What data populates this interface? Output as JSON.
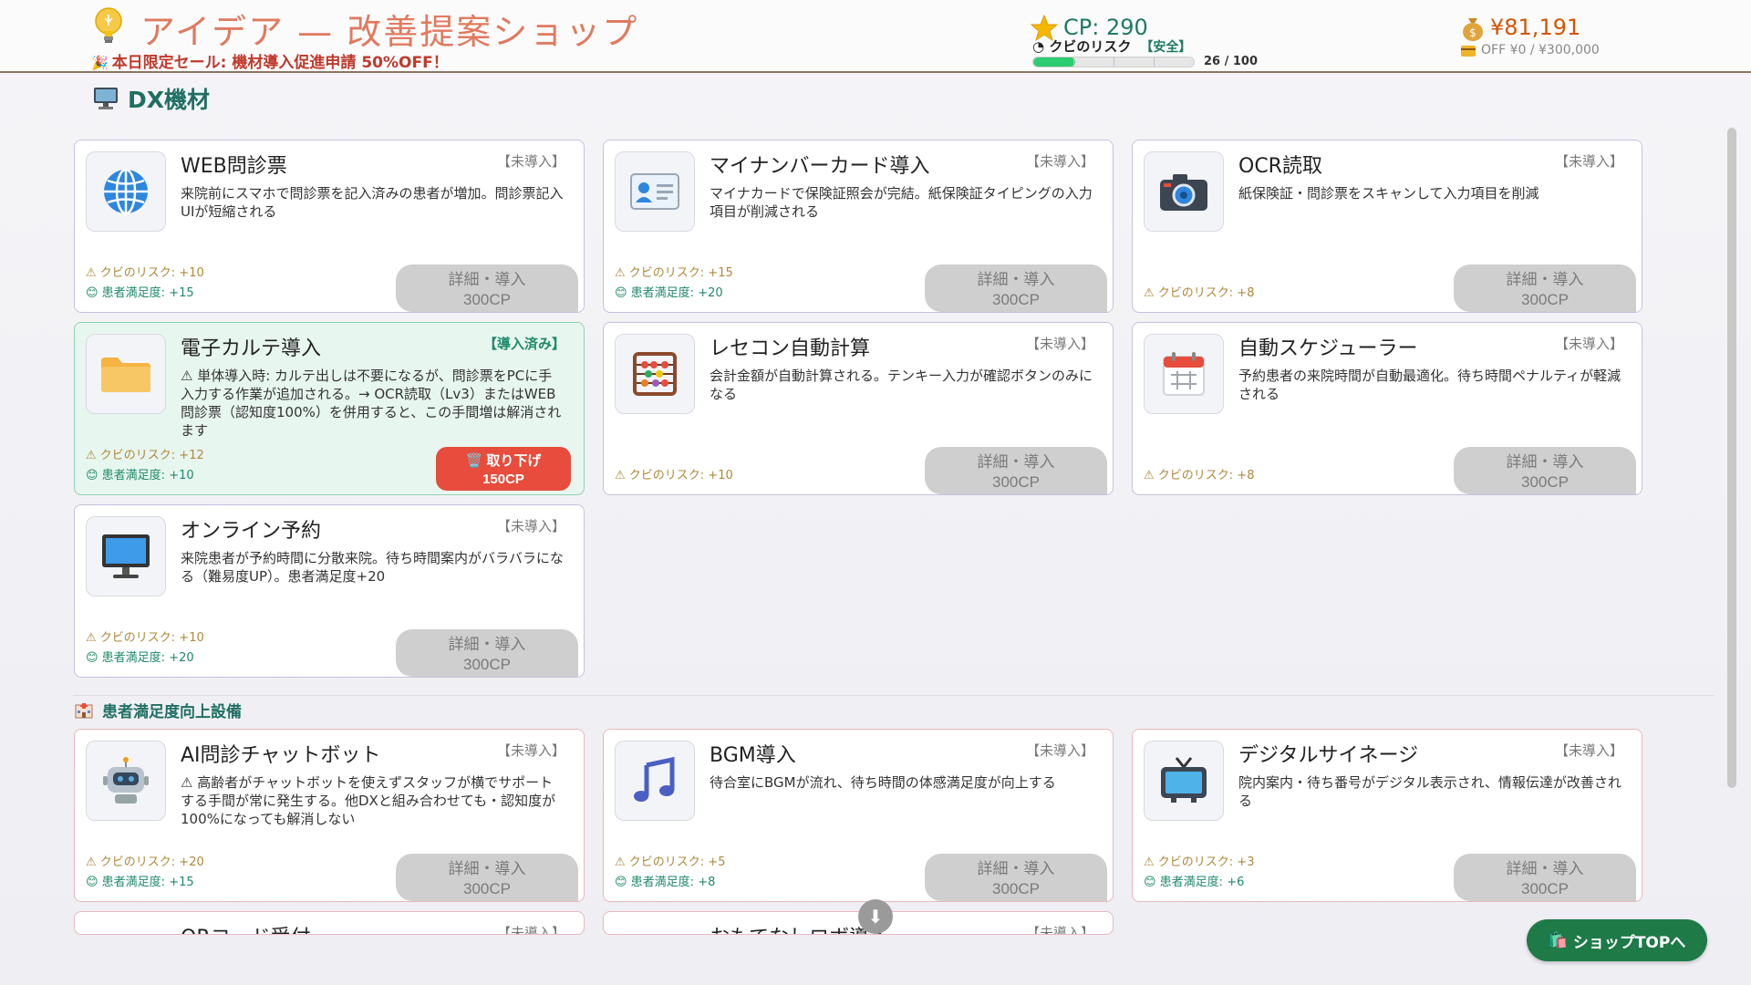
{
  "header": {
    "title": "アイデア — 改善提案ショップ",
    "sale": "本日限定セール: 機材導入促進申請 50%OFF！",
    "cp": "CP: 290",
    "risk_label": "クビのリスク",
    "risk_status": "【安全】",
    "risk_value": 26,
    "risk_max": 100,
    "risk_count": "26 / 100",
    "money": "¥81,191",
    "off_line": "OFF ¥0 / ¥300,000"
  },
  "sections": {
    "dx_title": "DX機材",
    "sat_title": "患者満足度向上設備"
  },
  "cards": [
    {
      "name": "WEB問診票",
      "status": "【未導入】",
      "desc": "来院前にスマホで問診票を記入済みの患者が増加。問診票記入UIが短縮される",
      "risk": "⚠ クビのリスク: +10",
      "satis": "😊 患者満足度: +15",
      "btn1": "詳細・導入",
      "btn2": "300CP"
    },
    {
      "name": "マイナンバーカード導入",
      "status": "【未導入】",
      "desc": "マイナカードで保険証照会が完結。紙保険証タイピングの入力項目が削減される",
      "risk": "⚠ クビのリスク: +15",
      "satis": "😊 患者満足度: +20",
      "btn1": "詳細・導入",
      "btn2": "300CP"
    },
    {
      "name": "OCR読取",
      "status": "【未導入】",
      "desc": "紙保険証・問診票をスキャンして入力項目を削減",
      "risk": "⚠ クビのリスク: +8",
      "satis": "",
      "btn1": "詳細・導入",
      "btn2": "300CP"
    },
    {
      "name": "電子カルテ導入",
      "status": "【導入済み】",
      "desc": "⚠ 単体導入時: カルテ出しは不要になるが、問診票をPCに手入力する作業が追加される。→ OCR読取（Lv3）またはWEB問診票（認知度100%）を併用すると、この手間増は解消されます",
      "risk": "⚠ クビのリスク: +12",
      "satis": "😊 患者満足度: +10",
      "btn1": "🗑️ 取り下げ",
      "btn2": "150CP"
    },
    {
      "name": "レセコン自動計算",
      "status": "【未導入】",
      "desc": "会計金額が自動計算される。テンキー入力が確認ボタンのみになる",
      "risk": "⚠ クビのリスク: +10",
      "satis": "",
      "btn1": "詳細・導入",
      "btn2": "300CP"
    },
    {
      "name": "自動スケジューラー",
      "status": "【未導入】",
      "desc": "予約患者の来院時間が自動最適化。待ち時間ペナルティが軽減される",
      "risk": "⚠ クビのリスク: +8",
      "satis": "",
      "btn1": "詳細・導入",
      "btn2": "300CP"
    },
    {
      "name": "オンライン予約",
      "status": "【未導入】",
      "desc": "来院患者が予約時間に分散来院。待ち時間案内がバラバラになる（難易度UP）。患者満足度+20",
      "risk": "⚠ クビのリスク: +10",
      "satis": "😊 患者満足度: +20",
      "btn1": "詳細・導入",
      "btn2": "300CP"
    },
    {
      "name": "AI問診チャットボット",
      "status": "【未導入】",
      "desc": "⚠ 高齢者がチャットボットを使えずスタッフが横でサポートする手間が常に発生する。他DXと組み合わせても・認知度が100%になっても解消しない",
      "risk": "⚠ クビのリスク: +20",
      "satis": "😊 患者満足度: +15",
      "btn1": "詳細・導入",
      "btn2": "300CP"
    },
    {
      "name": "BGM導入",
      "status": "【未導入】",
      "desc": "待合室にBGMが流れ、待ち時間の体感満足度が向上する",
      "risk": "⚠ クビのリスク: +5",
      "satis": "😊 患者満足度: +8",
      "btn1": "詳細・導入",
      "btn2": "300CP"
    },
    {
      "name": "デジタルサイネージ",
      "status": "【未導入】",
      "desc": "院内案内・待ち番号がデジタル表示され、情報伝達が改善される",
      "risk": "⚠ クビのリスク: +3",
      "satis": "😊 患者満足度: +6",
      "btn1": "詳細・導入",
      "btn2": "300CP"
    },
    {
      "name": "QRコード受付",
      "status": "【未導入】"
    },
    {
      "name": "おもてなしロボ導入",
      "status": "【未導入】"
    }
  ],
  "footer": {
    "shop_top": "ショップTOPへ"
  },
  "colors": {
    "accent": "#1f6f63",
    "title": "#e07a5f",
    "remove": "#e74c3c",
    "shop_top": "#1e7a46"
  }
}
